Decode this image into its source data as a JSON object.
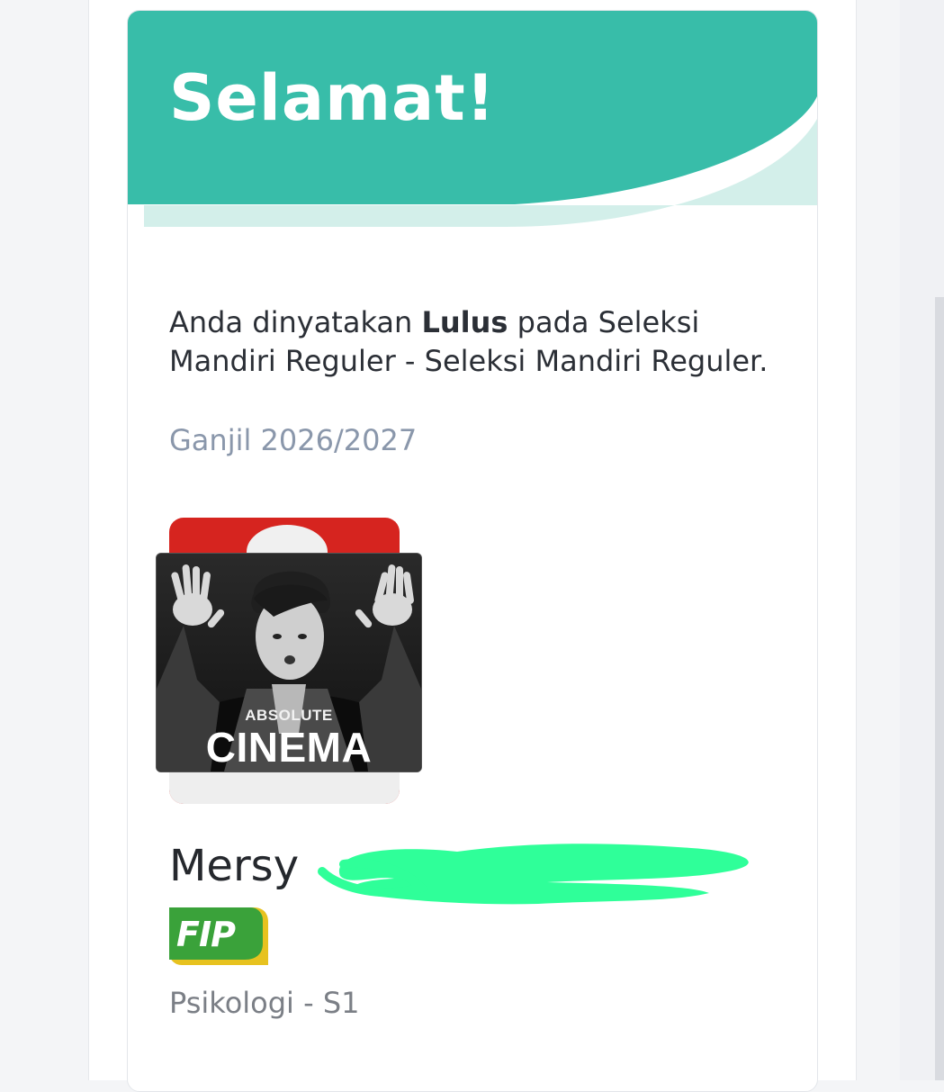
{
  "header": {
    "title": "Selamat!"
  },
  "result": {
    "prefix": "Anda dinyatakan ",
    "status": "Lulus",
    "suffix": " pada Seleksi Mandiri Reguler - Seleksi Mandiri Reguler.",
    "period": "Ganjil 2026/2027"
  },
  "photo": {
    "meme_line1": "ABSOLUTE",
    "meme_line2": "CINEMA"
  },
  "student": {
    "first_name": "Mersy",
    "faculty_logo_text": "FIP",
    "program": "Psikologi - S1"
  },
  "colors": {
    "header_teal": "#38bda9",
    "header_wave": "#d3efea",
    "redaction": "#2fff99",
    "logo_green": "#3aa23a",
    "logo_yellow": "#f3c221"
  }
}
